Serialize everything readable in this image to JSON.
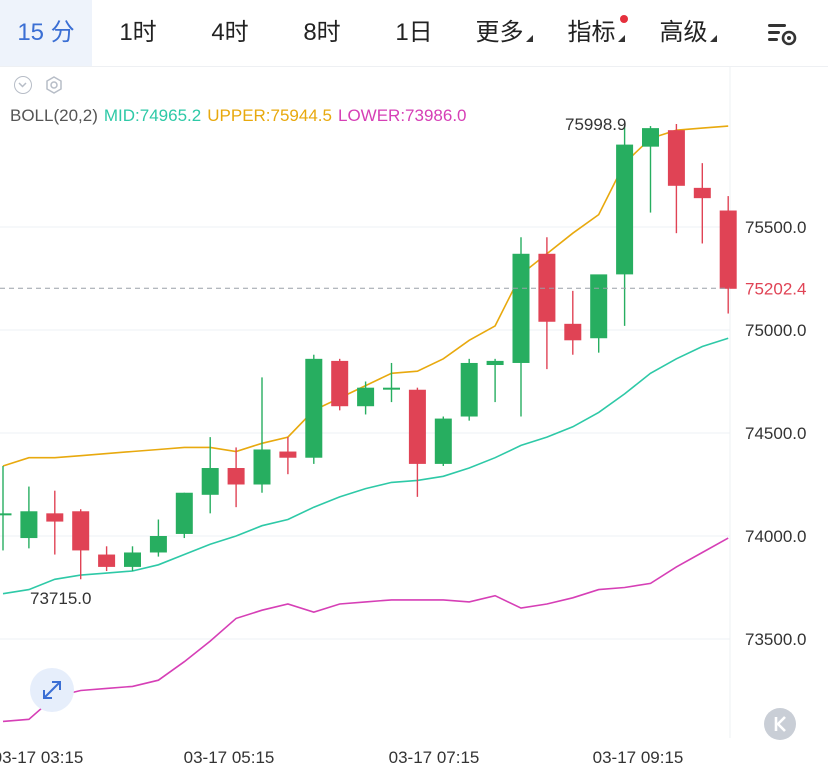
{
  "tabs": [
    {
      "label": "15 分",
      "active": true
    },
    {
      "label": "1时",
      "active": false
    },
    {
      "label": "4时",
      "active": false
    },
    {
      "label": "8时",
      "active": false
    },
    {
      "label": "1日",
      "active": false
    },
    {
      "label": "更多",
      "active": false,
      "dropdown": true
    },
    {
      "label": "指标",
      "active": false,
      "dropdown": true,
      "badge_dot": true
    },
    {
      "label": "高级",
      "active": false,
      "dropdown": true
    }
  ],
  "icons": {
    "settings": "chart-settings-icon",
    "collapse": "chevron-down-icon",
    "gear": "gear-icon",
    "expand": "expand-arrows-icon",
    "nav": "k-button-icon"
  },
  "legend": {
    "name": "BOLL(20,2)",
    "mid": "MID:74965.2",
    "upper": "UPPER:75944.5",
    "lower": "LOWER:73986.0"
  },
  "colors": {
    "up": "#27ae60",
    "down": "#e04355",
    "mid": "#2ec9a7",
    "upper": "#e8a90e",
    "lower": "#d63fb6",
    "accent": "#3b6fd4"
  },
  "chart_data": {
    "type": "candlestick",
    "y_ticks": [
      "75500.0",
      "75000.0",
      "74500.0",
      "74000.0",
      "73500.0"
    ],
    "ylim": [
      73045,
      76490
    ],
    "x_ticks": [
      "03-17 03:15",
      "03-17 05:15",
      "03-17 07:15",
      "03-17 09:15"
    ],
    "current_price": "75202.4",
    "high_label": "75998.9",
    "low_label": "73715.0",
    "candles": [
      {
        "o": 74110,
        "h": 74340,
        "l": 73930,
        "c": 74110
      },
      {
        "o": 73990,
        "h": 74240,
        "l": 73940,
        "c": 74120
      },
      {
        "o": 74110,
        "h": 74220,
        "l": 73910,
        "c": 74070
      },
      {
        "o": 74120,
        "h": 74130,
        "l": 73790,
        "c": 73930
      },
      {
        "o": 73910,
        "h": 73950,
        "l": 73830,
        "c": 73850
      },
      {
        "o": 73850,
        "h": 73950,
        "l": 73830,
        "c": 73920
      },
      {
        "o": 73920,
        "h": 74080,
        "l": 73900,
        "c": 74000
      },
      {
        "o": 74010,
        "h": 74210,
        "l": 73990,
        "c": 74210
      },
      {
        "o": 74200,
        "h": 74480,
        "l": 74110,
        "c": 74330
      },
      {
        "o": 74330,
        "h": 74430,
        "l": 74140,
        "c": 74250
      },
      {
        "o": 74250,
        "h": 74770,
        "l": 74210,
        "c": 74420
      },
      {
        "o": 74410,
        "h": 74480,
        "l": 74300,
        "c": 74380
      },
      {
        "o": 74380,
        "h": 74880,
        "l": 74350,
        "c": 74860
      },
      {
        "o": 74850,
        "h": 74860,
        "l": 74610,
        "c": 74630
      },
      {
        "o": 74630,
        "h": 74750,
        "l": 74590,
        "c": 74720
      },
      {
        "o": 74720,
        "h": 74840,
        "l": 74650,
        "c": 74720
      },
      {
        "o": 74710,
        "h": 74720,
        "l": 74190,
        "c": 74350
      },
      {
        "o": 74350,
        "h": 74580,
        "l": 74340,
        "c": 74570
      },
      {
        "o": 74580,
        "h": 74860,
        "l": 74560,
        "c": 74840
      },
      {
        "o": 74830,
        "h": 74860,
        "l": 74650,
        "c": 74850
      },
      {
        "o": 74840,
        "h": 75450,
        "l": 74580,
        "c": 75370
      },
      {
        "o": 75370,
        "h": 75450,
        "l": 74810,
        "c": 75040
      },
      {
        "o": 75030,
        "h": 75190,
        "l": 74880,
        "c": 74950
      },
      {
        "o": 74960,
        "h": 75260,
        "l": 74890,
        "c": 75270
      },
      {
        "o": 75270,
        "h": 75990,
        "l": 75020,
        "c": 75900
      },
      {
        "o": 75890,
        "h": 75990,
        "l": 75570,
        "c": 75980
      },
      {
        "o": 75970,
        "h": 76000,
        "l": 75470,
        "c": 75700
      },
      {
        "o": 75690,
        "h": 75810,
        "l": 75420,
        "c": 75640
      },
      {
        "o": 75580,
        "h": 75650,
        "l": 75080,
        "c": 75200
      }
    ],
    "upper": [
      74340,
      74380,
      74380,
      74390,
      74400,
      74410,
      74420,
      74430,
      74430,
      74410,
      74450,
      74480,
      74610,
      74670,
      74730,
      74790,
      74800,
      74860,
      74950,
      75020,
      75270,
      75370,
      75470,
      75560,
      75810,
      75930,
      75970,
      75980,
      75990
    ],
    "mid": [
      73720,
      73740,
      73790,
      73810,
      73820,
      73830,
      73860,
      73910,
      73960,
      74000,
      74050,
      74080,
      74140,
      74190,
      74230,
      74260,
      74270,
      74290,
      74330,
      74380,
      74440,
      74480,
      74530,
      74600,
      74690,
      74790,
      74860,
      74920,
      74960
    ],
    "lower": [
      73100,
      73110,
      73220,
      73250,
      73260,
      73270,
      73300,
      73390,
      73490,
      73600,
      73640,
      73670,
      73630,
      73670,
      73680,
      73690,
      73690,
      73690,
      73680,
      73710,
      73650,
      73670,
      73700,
      73740,
      73750,
      73770,
      73850,
      73920,
      73990
    ]
  }
}
